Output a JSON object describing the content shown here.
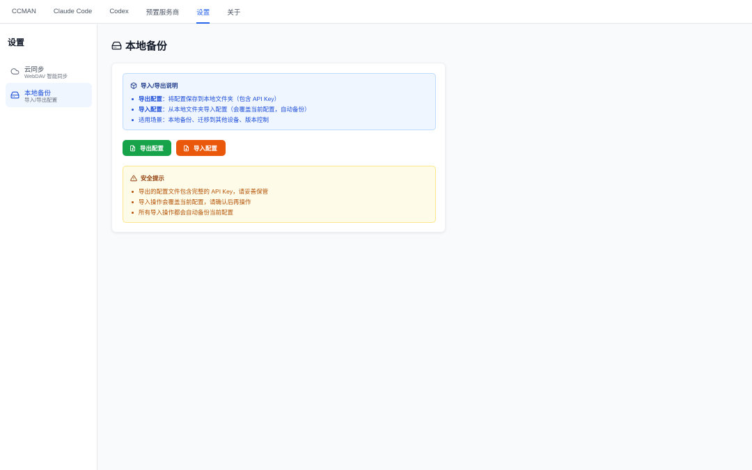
{
  "topnav": {
    "tabs": [
      {
        "label": "CCMAN"
      },
      {
        "label": "Claude Code"
      },
      {
        "label": "Codex"
      },
      {
        "label": "预置服务商"
      },
      {
        "label": "设置"
      },
      {
        "label": "关于"
      }
    ],
    "active_tab": "设置"
  },
  "sidebar": {
    "title": "设置",
    "items": [
      {
        "label": "云同步",
        "sub": "WebDAV 智能同步",
        "icon": "cloud-icon"
      },
      {
        "label": "本地备份",
        "sub": "导入/导出配置",
        "icon": "hard-drive-icon"
      }
    ],
    "active_item": "本地备份"
  },
  "page": {
    "title": "本地备份",
    "icon": "hard-drive-icon"
  },
  "info": {
    "title": "导入/导出说明",
    "icon": "package-icon",
    "items": [
      {
        "bold": "导出配置",
        "text": "：将配置保存到本地文件夹（包含 API Key）"
      },
      {
        "bold": "导入配置",
        "text": "：从本地文件夹导入配置（会覆盖当前配置，自动备份）"
      },
      {
        "bold": "",
        "text": "适用场景：本地备份、迁移到其他设备、版本控制"
      }
    ]
  },
  "actions": {
    "export_label": "导出配置",
    "import_label": "导入配置",
    "export_icon": "file-export-icon",
    "import_icon": "file-import-icon"
  },
  "warning": {
    "title": "安全提示",
    "icon": "alert-triangle-icon",
    "items": [
      "导出的配置文件包含完整的 API Key，请妥善保管",
      "导入操作会覆盖当前配置，请确认后再操作",
      "所有导入操作都会自动备份当前配置"
    ]
  },
  "colors": {
    "accent": "#2563eb",
    "export_button": "#16a34a",
    "import_button": "#ea580c",
    "info_bg": "#eff6ff",
    "warning_bg": "#fefce8"
  }
}
